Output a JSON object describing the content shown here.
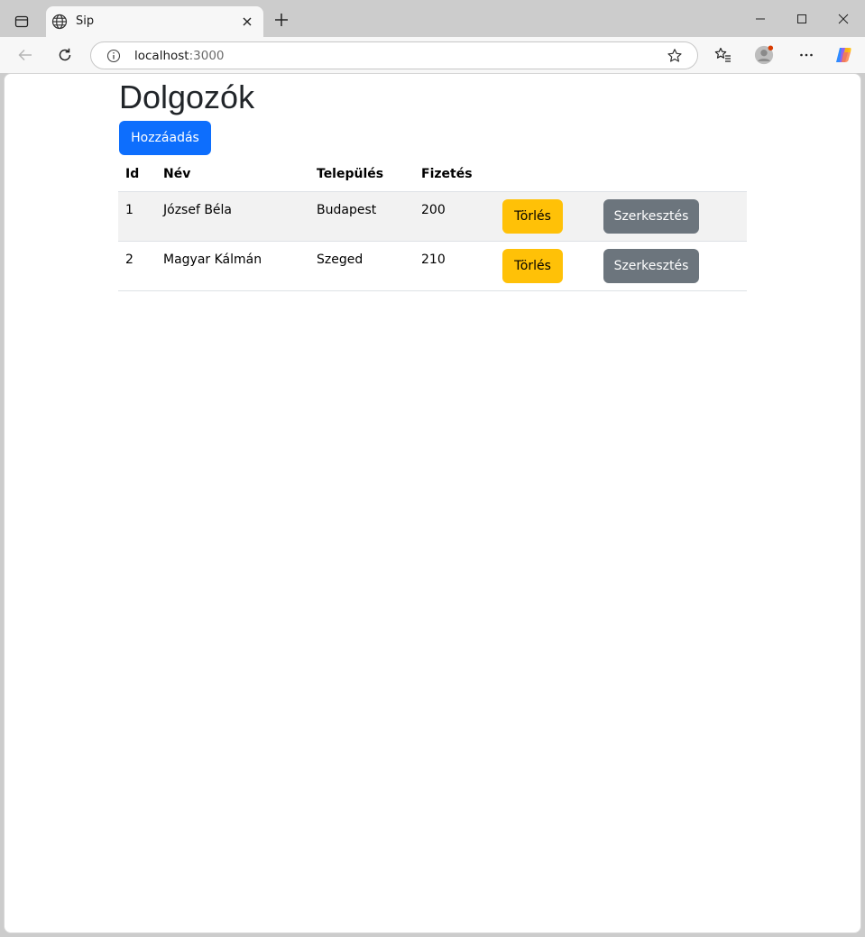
{
  "browser": {
    "tab_title": "Sip",
    "url_host": "localhost",
    "url_port": ":3000"
  },
  "page": {
    "title": "Dolgozók",
    "add_button": "Hozzáadás"
  },
  "table": {
    "headers": [
      "Id",
      "Név",
      "Település",
      "Fizetés"
    ],
    "rows": [
      {
        "id": "1",
        "name": "József Béla",
        "city": "Budapest",
        "salary": "200"
      },
      {
        "id": "2",
        "name": "Magyar Kálmán",
        "city": "Szeged",
        "salary": "210"
      }
    ],
    "delete_label": "Törlés",
    "edit_label": "Szerkesztés"
  },
  "colors": {
    "primary": "#0d6efd",
    "warning": "#ffc107",
    "secondary": "#6c757d",
    "stripe": "#f2f2f2"
  }
}
